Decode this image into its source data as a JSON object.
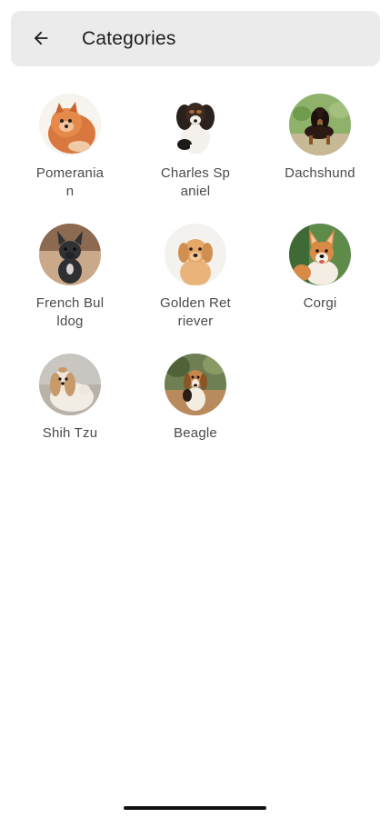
{
  "header": {
    "title": "Categories",
    "back_icon": "arrow-left-icon"
  },
  "categories": [
    {
      "label": "Pomeranian"
    },
    {
      "label": "Charles Spaniel"
    },
    {
      "label": "Dachshund"
    },
    {
      "label": "French Bulldog"
    },
    {
      "label": "Golden Retriever"
    },
    {
      "label": "Corgi"
    },
    {
      "label": "Shih Tzu"
    },
    {
      "label": "Beagle"
    }
  ]
}
